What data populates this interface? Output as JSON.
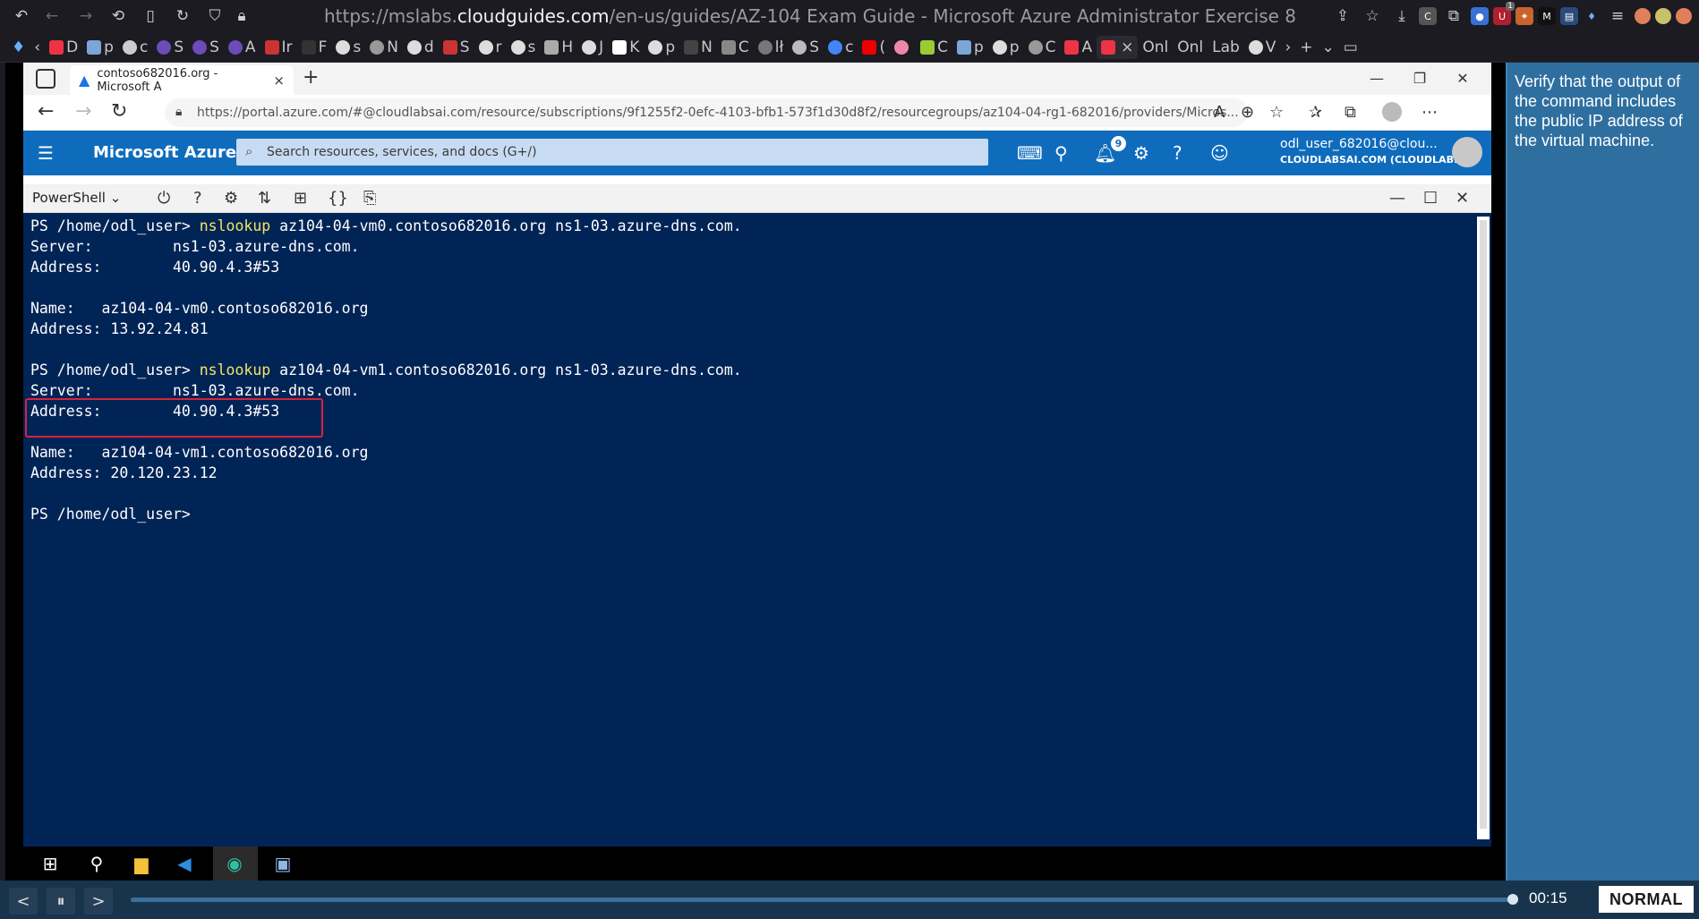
{
  "outer_browser": {
    "url_prefix": "https://mslabs.",
    "url_host": "cloudguides.com",
    "url_path": "/en-us/guides/AZ-104 Exam Guide - Microsoft Azure Administrator Exercise 8",
    "tabs": [
      {
        "label": "D"
      },
      {
        "label": "p"
      },
      {
        "label": "c"
      },
      {
        "label": "S"
      },
      {
        "label": "S"
      },
      {
        "label": "A"
      },
      {
        "label": "Ir"
      },
      {
        "label": "F"
      },
      {
        "label": "s"
      },
      {
        "label": "N"
      },
      {
        "label": "d"
      },
      {
        "label": "S"
      },
      {
        "label": "r"
      },
      {
        "label": "s"
      },
      {
        "label": "H"
      },
      {
        "label": "J"
      },
      {
        "label": "K"
      },
      {
        "label": "p"
      },
      {
        "label": "N"
      },
      {
        "label": "C"
      },
      {
        "label": "lł"
      },
      {
        "label": "S"
      },
      {
        "label": "c"
      },
      {
        "label": "("
      },
      {
        "label": ""
      },
      {
        "label": "C"
      },
      {
        "label": "p"
      },
      {
        "label": "p"
      },
      {
        "label": "C"
      },
      {
        "label": "A"
      },
      {
        "label": ""
      },
      {
        "label": "Onl"
      },
      {
        "label": "Onl"
      },
      {
        "label": "Lab"
      },
      {
        "label": "V"
      }
    ],
    "ext_badge": "1"
  },
  "edge": {
    "tab_title": "contoso682016.org - Microsoft A",
    "url": "https://portal.azure.com/#@cloudlabsai.com/resource/subscriptions/9f1255f2-0efc-4103-bfb1-573f1d30d8f2/resourcegroups/az104-04-rg1-682016/providers/Micros..."
  },
  "azure": {
    "brand": "Microsoft Azure",
    "search_placeholder": "Search resources, services, and docs (G+/)",
    "notification_count": "9",
    "user_name": "odl_user_682016@clou...",
    "user_tenant": "CLOUDLABSAI.COM (CLOUDLAB..."
  },
  "cloud_shell": {
    "shell_selector": "PowerShell",
    "lines": [
      {
        "prompt": "PS /home/odl_user> ",
        "cmd": "nslookup",
        "args": " az104-04-vm0.contoso682016.org ns1-03.azure-dns.com."
      },
      {
        "text": "Server:         ns1-03.azure-dns.com."
      },
      {
        "text": "Address:        40.90.4.3#53"
      },
      {
        "text": ""
      },
      {
        "text": "Name:   az104-04-vm0.contoso682016.org"
      },
      {
        "text": "Address: 13.92.24.81"
      },
      {
        "text": ""
      },
      {
        "prompt": "PS /home/odl_user> ",
        "cmd": "nslookup",
        "args": " az104-04-vm1.contoso682016.org ns1-03.azure-dns.com."
      },
      {
        "text": "Server:         ns1-03.azure-dns.com."
      },
      {
        "text": "Address:        40.90.4.3#53"
      },
      {
        "text": ""
      },
      {
        "text": "Name:   az104-04-vm1.contoso682016.org"
      },
      {
        "text": "Address: 20.120.23.12"
      },
      {
        "text": ""
      },
      {
        "text": "PS /home/odl_user>"
      }
    ]
  },
  "side_panel": {
    "instruction": "Verify that the output of the command includes the public IP address of the virtual machine."
  },
  "player": {
    "time": "00:15",
    "speed": "NORMAL",
    "progress": 0.99
  }
}
